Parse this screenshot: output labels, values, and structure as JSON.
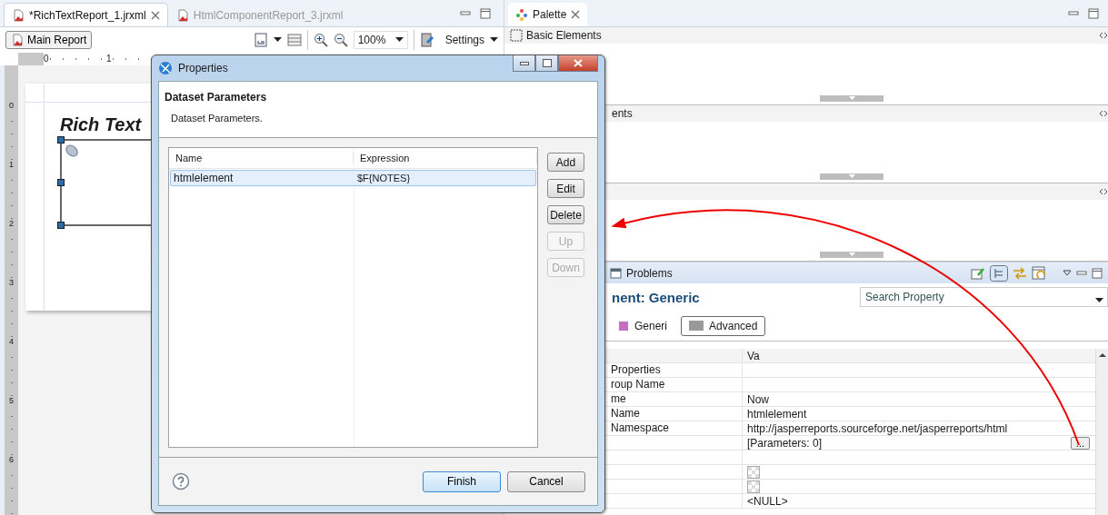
{
  "editor": {
    "tabs": [
      {
        "label": "*RichTextReport_1.jrxml",
        "selected": true,
        "closable": true
      },
      {
        "label": "HtmlComponentReport_3.jrxml",
        "selected": false,
        "closable": false
      }
    ],
    "toolbar": {
      "report_button": "Main Report",
      "zoom": "100%",
      "settings": "Settings"
    },
    "ruler": {
      "horizontal": [
        "0",
        "1"
      ],
      "vertical": [
        "0",
        "1",
        "2",
        "3",
        "4",
        "5",
        "6"
      ]
    },
    "page": {
      "title": "Rich Text"
    }
  },
  "palette": {
    "tab": "Palette",
    "sections": [
      {
        "kind": "icon",
        "title": "Basic Elements"
      },
      {
        "kind": "covered",
        "title": "ents"
      },
      {
        "kind": "covered"
      }
    ]
  },
  "properties_view": {
    "tab": "Problems",
    "title": "nent: Generic",
    "search": {
      "placeholder": "Search Property"
    },
    "tabs": [
      {
        "label": "Generi",
        "selected": false
      },
      {
        "label": "Advanced",
        "selected": true
      }
    ],
    "value_column": "Va",
    "rows": [
      {
        "kind": "text",
        "label": "Properties"
      },
      {
        "kind": "text",
        "label": "roup Name"
      },
      {
        "kind": "text",
        "label": "me",
        "value": "Now"
      },
      {
        "kind": "text",
        "label": "Name",
        "value": "htmlelement"
      },
      {
        "kind": "text",
        "label": "Namespace",
        "value": "http://jasperreports.sourceforge.net/jasperreports/html"
      },
      {
        "kind": "dialog",
        "value": "[Parameters: 0]",
        "button": "..."
      },
      {
        "kind": "text"
      },
      {
        "kind": "pattern"
      },
      {
        "kind": "pattern"
      },
      {
        "kind": "text",
        "value": "<NULL>"
      }
    ]
  },
  "dialog": {
    "title": "Properties",
    "heading": "Dataset Parameters",
    "description": "Dataset Parameters.",
    "columns": [
      "Name",
      "Expression"
    ],
    "rows": [
      {
        "name": "htmlelement",
        "expression": "$F{NOTES}",
        "selected": true
      }
    ],
    "side_buttons": [
      {
        "label": "Add",
        "disabled": false
      },
      {
        "label": "Edit",
        "disabled": false
      },
      {
        "label": "Delete",
        "disabled": false
      },
      {
        "label": "Up",
        "disabled": true
      },
      {
        "label": "Down",
        "disabled": true
      }
    ],
    "buttons": [
      {
        "label": "Finish",
        "default": true
      },
      {
        "label": "Cancel",
        "default": false
      }
    ]
  }
}
